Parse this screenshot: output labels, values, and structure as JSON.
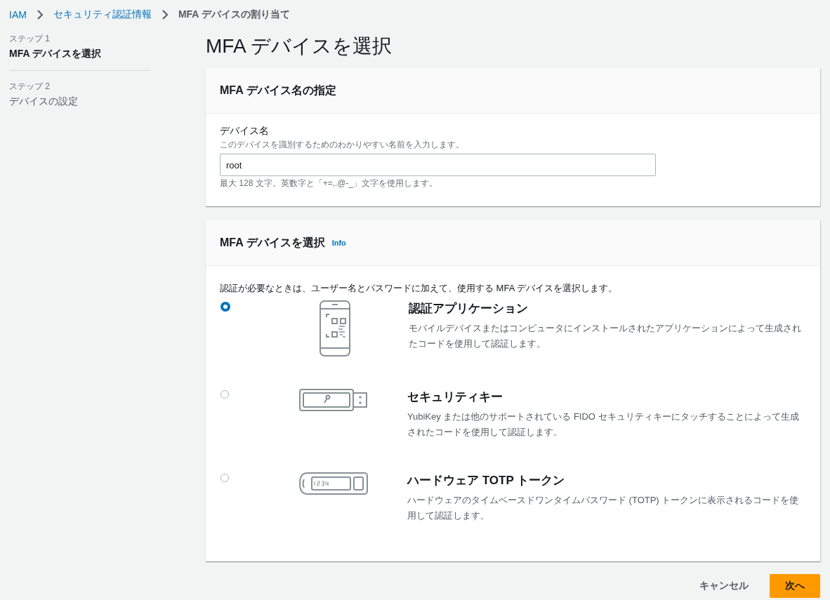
{
  "breadcrumb": [
    {
      "label": "IAM",
      "link": true
    },
    {
      "label": "セキュリティ認証情報",
      "link": true
    },
    {
      "label": "MFA デバイスの割り当て",
      "link": false
    }
  ],
  "steps": [
    {
      "step": "ステップ 1",
      "label": "MFA デバイスを選択",
      "selected": true
    },
    {
      "step": "ステップ 2",
      "label": "デバイスの設定",
      "selected": false
    }
  ],
  "page_title": "MFA デバイスを選択",
  "name_card": {
    "title": "MFA デバイス名の指定",
    "field_label": "デバイス名",
    "description": "このデバイスを識別するためのわかりやすい名前を入力します。",
    "value": "root",
    "constraint": "最大 128 文字。英数字と「+=,.@-_」文字を使用します。"
  },
  "device_card": {
    "title": "MFA デバイスを選択",
    "info": "Info",
    "intro": "認証が必要なときは、ユーザー名とパスワードに加えて、使用する MFA デバイスを選択します。",
    "options": [
      {
        "kind": "app",
        "title": "認証アプリケーション",
        "description": "モバイルデバイスまたはコンピュータにインストールされたアプリケーションによって生成されたコードを使用して認証します。",
        "selected": true
      },
      {
        "kind": "key",
        "title": "セキュリティキー",
        "description": "YubiKey または他のサポートされている FIDO セキュリティキーにタッチすることによって生成されたコードを使用して認証します。",
        "selected": false
      },
      {
        "kind": "token",
        "title": "ハードウェア TOTP トークン",
        "description": "ハードウェアのタイムベースドワンタイムパスワード (TOTP) トークンに表示されるコードを使用して認証します。",
        "selected": false
      }
    ]
  },
  "buttons": {
    "cancel": "キャンセル",
    "next": "次へ"
  }
}
